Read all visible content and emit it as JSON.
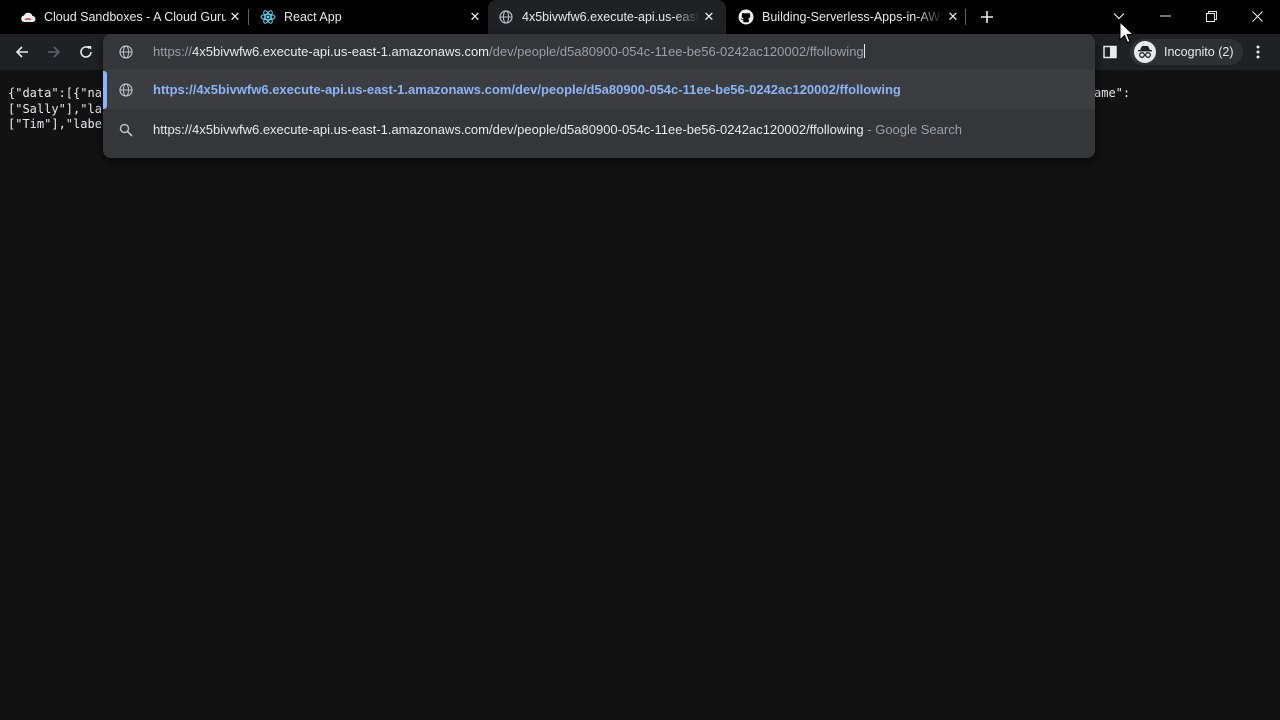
{
  "tabs": [
    {
      "title": "Cloud Sandboxes - A Cloud Guru",
      "icon": "cloud-icon"
    },
    {
      "title": "React App",
      "icon": "react-icon"
    },
    {
      "title": "4x5bivwfw6.execute-api.us-east-",
      "icon": "globe-icon",
      "active": true
    },
    {
      "title": "Building-Serverless-Apps-in-AWS",
      "icon": "github-icon"
    }
  ],
  "toolbar": {
    "incognito_label": "Incognito (2)"
  },
  "omnibox": {
    "input_scheme": "https://",
    "input_host": "4x5bivwfw6.execute-api.us-east-1.amazonaws.com",
    "input_path": "/dev/people/d5a80900-054c-11ee-be56-0242ac120002/ffollowing",
    "suggestions": [
      {
        "text": "https://4x5bivwfw6.execute-api.us-east-1.amazonaws.com/dev/people/d5a80900-054c-11ee-be56-0242ac120002/ffollowing",
        "type": "url",
        "selected": true
      },
      {
        "text": "https://4x5bivwfw6.execute-api.us-east-1.amazonaws.com/dev/people/d5a80900-054c-11ee-be56-0242ac120002/ffollowing",
        "suffix": " - Google Search",
        "type": "search"
      }
    ]
  },
  "page": {
    "json_lines": [
      "{\"data\":[{\"na",
      "[\"Sally\"],\"la",
      "[\"Tim\"],\"labe"
    ],
    "right_fragment": "ame\":"
  },
  "colors": {
    "background": "#121212",
    "tabstrip": "#000000",
    "toolbar": "#202124",
    "omnibox": "#35363a",
    "link": "#8ab4f8"
  }
}
